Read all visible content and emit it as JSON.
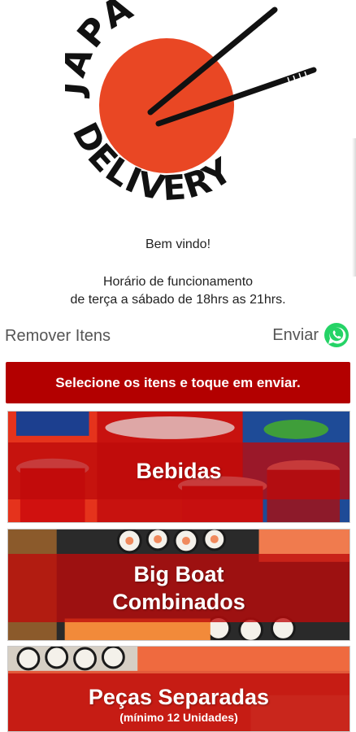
{
  "logo": {
    "line1": "JAPA",
    "line2": "DELIVERY",
    "sun_color": "#e94724",
    "ink_color": "#111111"
  },
  "welcome": {
    "greeting": "Bem vindo!",
    "hours_title": "Horário de funcionamento",
    "hours_text": "de terça a sábado de 18hrs as 21hrs."
  },
  "actions": {
    "remove_label": "Remover Itens",
    "send_label": "Enviar",
    "send_icon": "whatsapp-icon",
    "whatsapp_color": "#25d366"
  },
  "banner": {
    "text": "Selecione os itens e toque em enviar.",
    "color": "#b30000"
  },
  "categories": [
    {
      "title": "Bebidas",
      "subtitle": ""
    },
    {
      "title": "Big Boat\nCombinados",
      "subtitle": ""
    },
    {
      "title": "Peças Separadas",
      "subtitle": "(mínimo 12 Unidades)"
    }
  ]
}
